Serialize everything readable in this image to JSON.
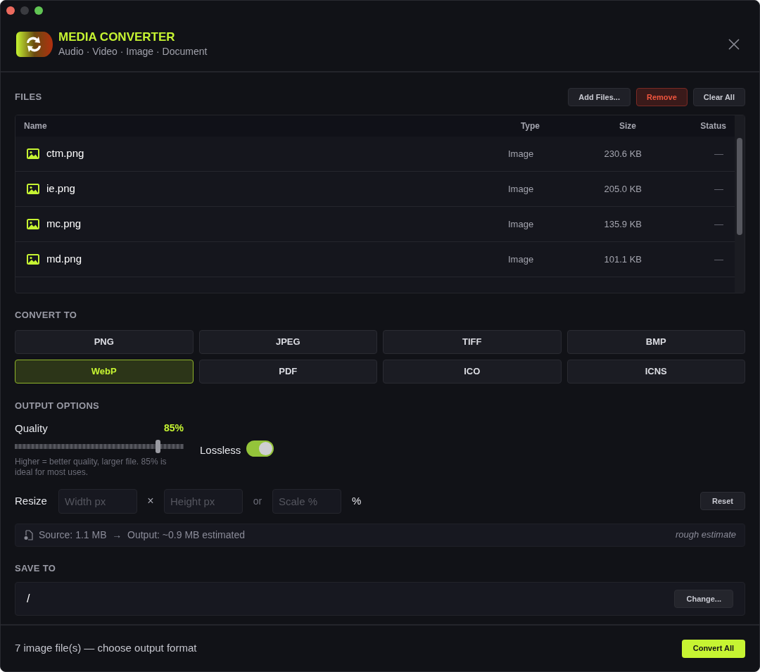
{
  "app": {
    "title": "MEDIA CONVERTER",
    "subtitle": "Audio · Video · Image · Document"
  },
  "files": {
    "heading": "FILES",
    "actions": [
      {
        "label": "Add Files...",
        "kind": "normal"
      },
      {
        "label": "Remove",
        "kind": "danger"
      },
      {
        "label": "Clear All",
        "kind": "normal"
      }
    ],
    "columns": [
      "Name",
      "Type",
      "Size",
      "Status"
    ],
    "rows": [
      {
        "name": "ctm.png",
        "type": "Image",
        "size": "230.6 KB",
        "status": "—"
      },
      {
        "name": "ie.png",
        "type": "Image",
        "size": "205.0 KB",
        "status": "—"
      },
      {
        "name": "mc.png",
        "type": "Image",
        "size": "135.9 KB",
        "status": "—"
      },
      {
        "name": "md.png",
        "type": "Image",
        "size": "101.1 KB",
        "status": "—"
      }
    ]
  },
  "convert_to": {
    "heading": "CONVERT TO",
    "formats": [
      {
        "label": "PNG",
        "selected": false
      },
      {
        "label": "JPEG",
        "selected": false
      },
      {
        "label": "TIFF",
        "selected": false
      },
      {
        "label": "BMP",
        "selected": false
      },
      {
        "label": "WebP",
        "selected": true
      },
      {
        "label": "PDF",
        "selected": false
      },
      {
        "label": "ICO",
        "selected": false
      },
      {
        "label": "ICNS",
        "selected": false
      }
    ]
  },
  "output_options": {
    "heading": "OUTPUT OPTIONS",
    "quality": {
      "label": "Quality",
      "reading": "85%",
      "level": 0.85,
      "hint": "Higher = better quality, larger file. 85% is ideal for most uses."
    },
    "lossless": {
      "label": "Lossless",
      "on": true
    },
    "resize": {
      "label": "Resize",
      "width_placeholder": "Width px",
      "times": "×",
      "height_placeholder": "Height px",
      "or": "or",
      "scale_placeholder": "Scale %",
      "unit": "%",
      "reset": "Reset"
    },
    "estimate": {
      "text": "Source: 1.1 MB  →  Output: ~0.9 MB estimated",
      "note": "rough estimate"
    }
  },
  "save_to": {
    "heading": "SAVE TO",
    "path": "/",
    "change": "Change..."
  },
  "footer": {
    "status": "7 image file(s) — choose output format",
    "convert": "Convert All"
  }
}
